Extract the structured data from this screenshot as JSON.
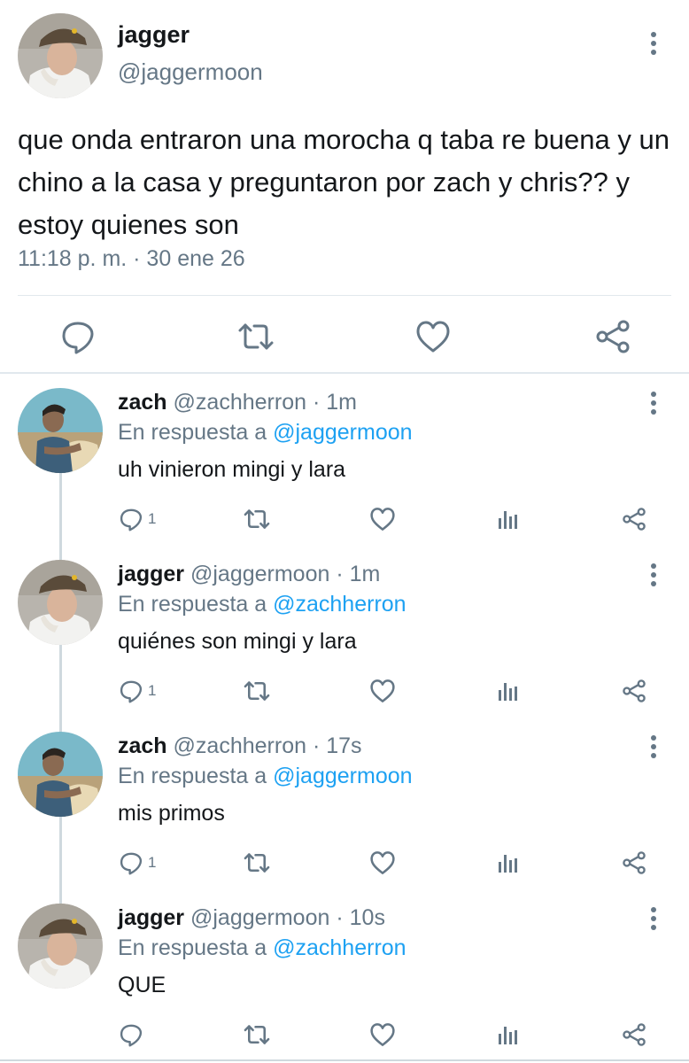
{
  "main_tweet": {
    "name": "jagger",
    "handle": "@jaggermoon",
    "text": "que onda entraron una morocha q taba re buena y un chino a la casa y preguntaron por zach y chris?? y estoy quienes son",
    "timestamp": "11:18 p. m. · 30 ene 26",
    "actions": [
      "reply-icon",
      "retweet-icon",
      "like-icon",
      "share-icon"
    ]
  },
  "replies": [
    {
      "name": "zach",
      "handle": "@zachherron",
      "time": "· 1m",
      "in_reply_prefix": "En respuesta a",
      "in_reply_to": "@jaggermoon",
      "text": "uh vinieron mingi y lara",
      "reply_count": "1"
    },
    {
      "name": "jagger",
      "handle": "@jaggermoon",
      "time": "· 1m",
      "in_reply_prefix": "En respuesta a",
      "in_reply_to": "@zachherron",
      "text": "quiénes son mingi y lara",
      "reply_count": "1"
    },
    {
      "name": "zach",
      "handle": "@zachherron",
      "time": "· 17s",
      "in_reply_prefix": "En respuesta a",
      "in_reply_to": "@jaggermoon",
      "text": "mis primos",
      "reply_count": "1"
    },
    {
      "name": "jagger",
      "handle": "@jaggermoon",
      "time": "· 10s",
      "in_reply_prefix": "En respuesta a",
      "in_reply_to": "@zachherron",
      "text": "QUE",
      "reply_count": ""
    }
  ],
  "colors": {
    "link": "#1da1f2",
    "secondary": "#657786",
    "text": "#14171a",
    "border": "#e1e8ed"
  }
}
